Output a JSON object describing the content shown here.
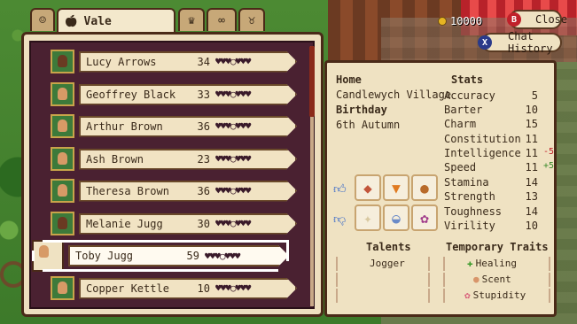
{
  "coins": "10000",
  "buttons": {
    "close": "Close",
    "close_key": "B",
    "chat_history": "Chat History",
    "chat_key": "X"
  },
  "tabs": {
    "active": "Vale"
  },
  "villagers": [
    {
      "name": "Lucy Arrows",
      "value": "34",
      "hearts": "♥♥♥○♥♥♥"
    },
    {
      "name": "Geoffrey Black",
      "value": "33",
      "hearts": "♥♥♥○♥♥♥"
    },
    {
      "name": "Arthur Brown",
      "value": "36",
      "hearts": "♥♥♥○♥♥♥"
    },
    {
      "name": "Ash Brown",
      "value": "23",
      "hearts": "♥♥♥○♥♥♥"
    },
    {
      "name": "Theresa Brown",
      "value": "36",
      "hearts": "♥♥♥○♥♥♥"
    },
    {
      "name": "Melanie Jugg",
      "value": "30",
      "hearts": "♥♥♥○♥♥♥"
    },
    {
      "name": "Toby Jugg",
      "value": "59",
      "hearts": "♥♥♥○♥♥♥"
    },
    {
      "name": "Copper Kettle",
      "value": "10",
      "hearts": "♥♥♥○♥♥♥"
    }
  ],
  "profile": {
    "home_label": "Home",
    "home": "Candlewych Village",
    "birthday_label": "Birthday",
    "birthday": "6th Autumn"
  },
  "stats_title": "Stats",
  "stats": [
    {
      "name": "Accuracy",
      "value": "5",
      "mod": ""
    },
    {
      "name": "Barter",
      "value": "10",
      "mod": ""
    },
    {
      "name": "Charm",
      "value": "15",
      "mod": ""
    },
    {
      "name": "Constitution",
      "value": "11",
      "mod": ""
    },
    {
      "name": "Intelligence",
      "value": "11",
      "mod": "-5"
    },
    {
      "name": "Speed",
      "value": "11",
      "mod": "+5"
    },
    {
      "name": "Stamina",
      "value": "14",
      "mod": ""
    },
    {
      "name": "Strength",
      "value": "13",
      "mod": ""
    },
    {
      "name": "Toughness",
      "value": "14",
      "mod": ""
    },
    {
      "name": "Virility",
      "value": "10",
      "mod": ""
    }
  ],
  "likes": [
    "meat-icon",
    "carrot-icon",
    "drumstick-icon"
  ],
  "dislikes": [
    "bone-icon",
    "bowl-icon",
    "vegetables-icon"
  ],
  "talents_title": "Talents",
  "talents": [
    "Jogger",
    "",
    ""
  ],
  "traits_title": "Temporary Traits",
  "traits": [
    {
      "icon": "plus-icon",
      "glyph": "✚",
      "color": "#3a9a2a",
      "name": "Healing"
    },
    {
      "icon": "nose-icon",
      "glyph": "●",
      "color": "#d8956a",
      "name": "Scent"
    },
    {
      "icon": "brain-icon",
      "glyph": "✿",
      "color": "#d8607a",
      "name": "Stupidity"
    }
  ]
}
